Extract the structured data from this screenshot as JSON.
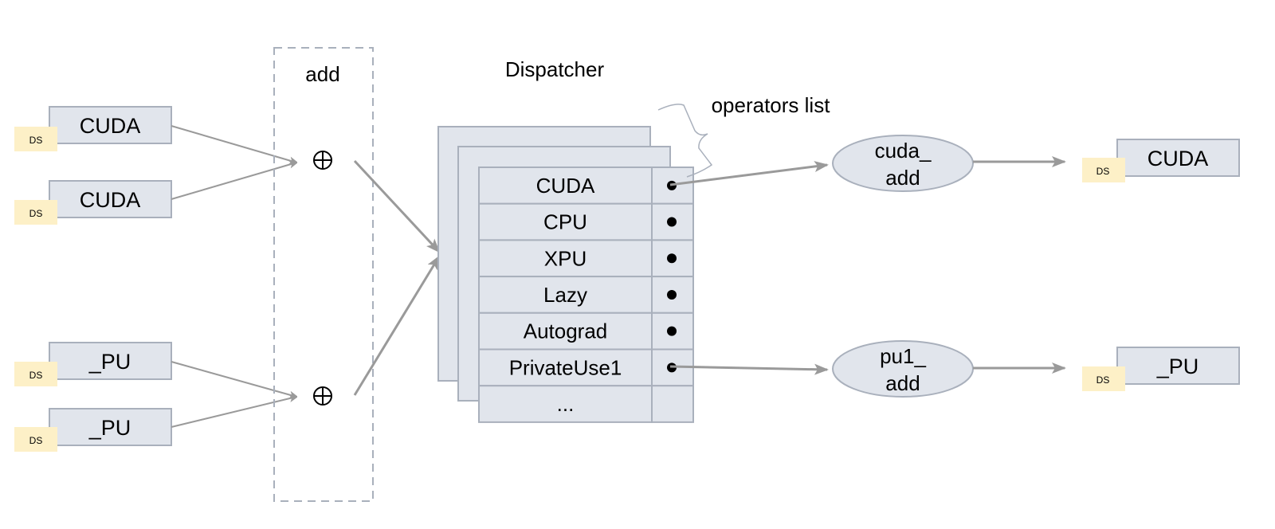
{
  "diagram": {
    "add_group": {
      "title": "add",
      "operator_symbol": "⊕"
    },
    "dispatcher": {
      "title": "Dispatcher",
      "annotation": "operators list",
      "rows": [
        {
          "label": "CUDA",
          "has_pointer": true
        },
        {
          "label": "CPU",
          "has_pointer": true
        },
        {
          "label": "XPU",
          "has_pointer": true
        },
        {
          "label": "Lazy",
          "has_pointer": true
        },
        {
          "label": "Autograd",
          "has_pointer": true
        },
        {
          "label": "PrivateUse1",
          "has_pointer": true
        },
        {
          "label": "...",
          "has_pointer": false
        }
      ]
    },
    "inputs": [
      {
        "label": "CUDA",
        "tag": "DS"
      },
      {
        "label": "CUDA",
        "tag": "DS"
      },
      {
        "label": "_PU",
        "tag": "DS"
      },
      {
        "label": "_PU",
        "tag": "DS"
      }
    ],
    "kernels": [
      {
        "line1": "cuda_",
        "line2": "add"
      },
      {
        "line1": "pu1_",
        "line2": "add"
      }
    ],
    "outputs": [
      {
        "label": "CUDA",
        "tag": "DS"
      },
      {
        "label": "_PU",
        "tag": "DS"
      }
    ],
    "colors": {
      "box_fill": "#e1e5ec",
      "box_stroke": "#a9b0bc",
      "ds_fill": "#fdf0c7",
      "arrow": "#9a9a9a"
    }
  }
}
